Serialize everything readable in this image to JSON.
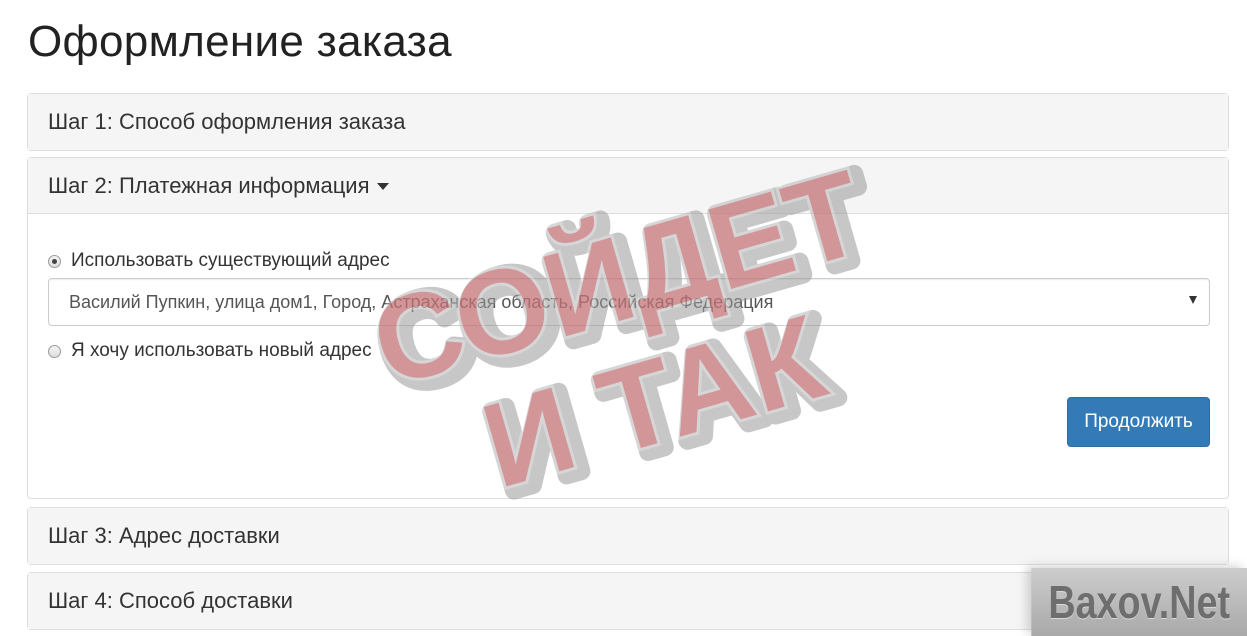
{
  "page": {
    "title": "Оформление заказа"
  },
  "steps": [
    {
      "label": "Шаг 1: Способ оформления заказа"
    },
    {
      "label": "Шаг 2: Платежная информация"
    },
    {
      "label": "Шаг 3: Адрес доставки"
    },
    {
      "label": "Шаг 4: Способ доставки"
    }
  ],
  "payment": {
    "existing_label": "Использовать существующий адрес",
    "existing_selected": true,
    "address_value": "Василий Пупкин, улица дом1, Город, Астраханская область, Российская Федерация",
    "new_label": "Я хочу использовать новый адрес",
    "continue_label": "Продолжить"
  },
  "stamp": {
    "line1": "СОЙДЕТ",
    "line2": "И ТАК",
    "color": "#e05b63"
  },
  "watermark": {
    "text": "Baxov.Net"
  },
  "colors": {
    "primary": "#337ab7",
    "panel_heading_bg": "#f5f5f5",
    "border": "#dddddd"
  }
}
